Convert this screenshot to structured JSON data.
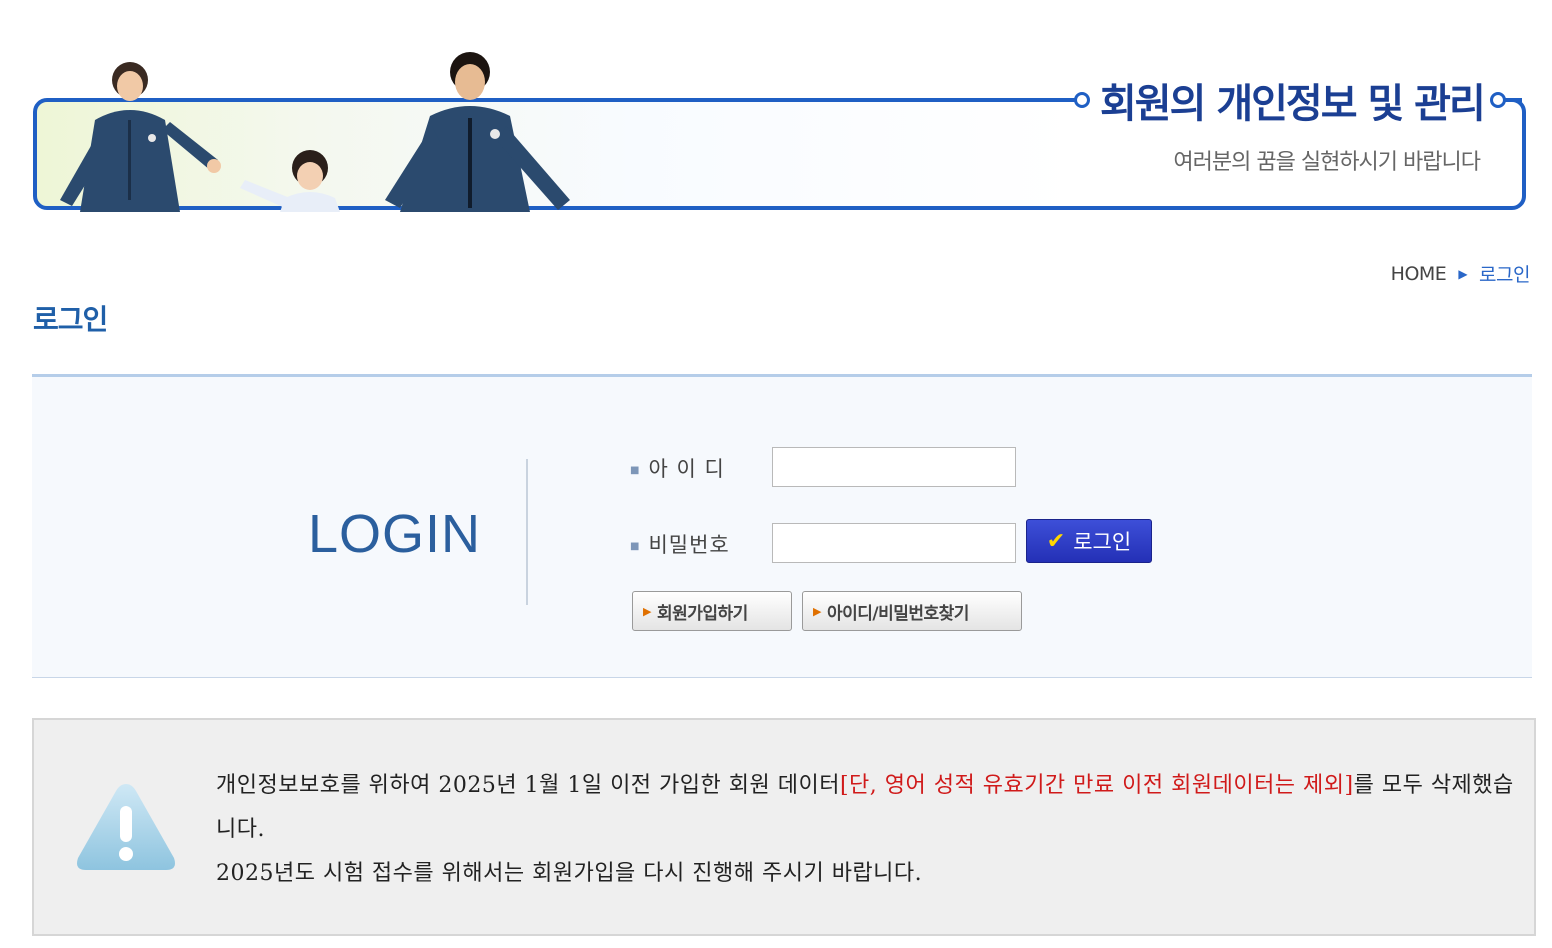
{
  "banner": {
    "title": "회원의 개인정보 및 관리",
    "subtitle": "여러분의 꿈을 실현하시기 바랍니다"
  },
  "breadcrumb": {
    "home": "HOME",
    "current": "로그인"
  },
  "page": {
    "title": "로그인"
  },
  "login": {
    "heading": "LOGIN",
    "id_label": "아 이 디",
    "id_value": "",
    "password_label": "비밀번호",
    "password_value": "",
    "login_button": "로그인",
    "signup_button": "회원가입하기",
    "find_button": "아이디/비밀번호찾기"
  },
  "notice": {
    "line1_a": "개인정보보호를 위하여 2025년 1월 1일 이전 가입한 회원 데이터",
    "line1_red": "[단, 영어 성적 유효기간 만료 이전 회원데이터는 제외]",
    "line1_b": "를 모두 삭제했습니다.",
    "line2": "2025년도 시험 접수를 위해서는 회원가입을 다시 진행해 주시기 바랍니다."
  },
  "colors": {
    "brand_blue": "#1f5fc4",
    "login_button": "#2a36c4",
    "notice_red": "#d01a1a"
  }
}
